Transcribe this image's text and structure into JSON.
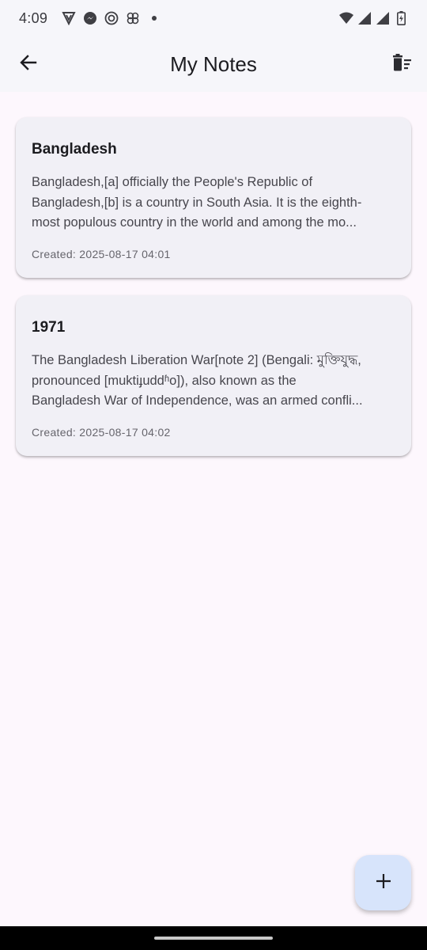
{
  "status_bar": {
    "time": "4:09",
    "left_icons": [
      "shield-app-icon",
      "messenger-icon",
      "camera-app-icon",
      "pinwheel-app-icon",
      "notification-dot"
    ],
    "right_icons": [
      "wifi-icon",
      "signal-icon",
      "signal-icon",
      "battery-icon"
    ]
  },
  "app_bar": {
    "title": "My Notes",
    "back_icon": "arrow-back-icon",
    "action_icon": "delete-sweep-icon"
  },
  "notes": [
    {
      "title": "Bangladesh",
      "body_lines": [
        "Bangladesh,[a] officially the People's Republic of",
        "Bangladesh,[b] is a country in South Asia. It is the eighth-",
        "most populous country in the world and among the mo..."
      ],
      "created": "Created: 2025-08-17 04:01"
    },
    {
      "title": "1971",
      "body_lines": [
        "The Bangladesh Liberation War[note 2] (Bengali: মুক্তিযুদ্ধ,",
        "pronounced [muktiɟuddʱo]), also known as the",
        "Bangladesh War of Independence, was an armed confli..."
      ],
      "created": "Created: 2025-08-17 04:02"
    }
  ],
  "fab": {
    "icon": "plus-icon"
  },
  "colors": {
    "background": "#fdf7fd",
    "app_bar": "#f6f6fa",
    "card": "#f1f0f6",
    "fab": "#d7e4fb"
  }
}
